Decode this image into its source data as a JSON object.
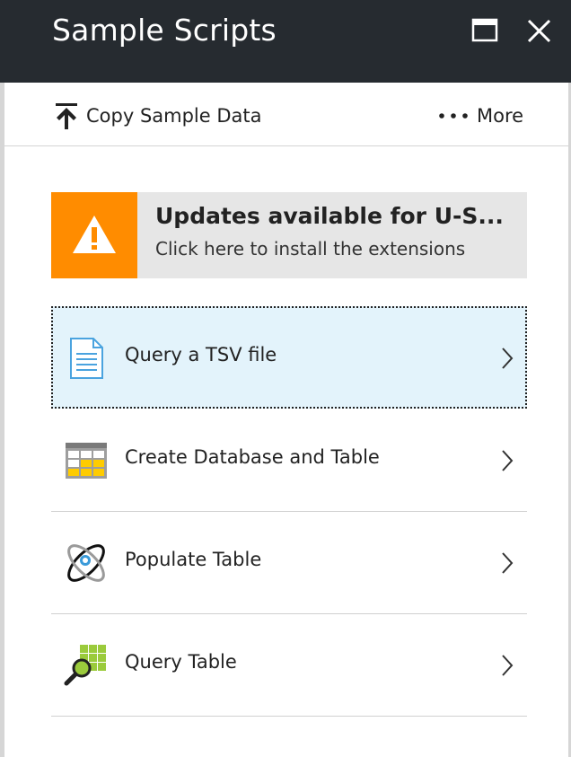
{
  "header": {
    "title": "Sample Scripts",
    "maximize_icon": "maximize-icon",
    "close_icon": "close-icon"
  },
  "toolbar": {
    "copy_label": "Copy Sample Data",
    "copy_icon": "upload-arrow-icon",
    "more_label": "More",
    "more_icon": "ellipsis-icon"
  },
  "banner": {
    "title": "Updates available for U-S...",
    "subtitle": "Click here to install the extensions",
    "icon": "warning-icon",
    "accent_color": "#ff8c00"
  },
  "items": [
    {
      "label": "Query a TSV file",
      "icon": "tsv-file-icon",
      "selected": true
    },
    {
      "label": "Create Database and Table",
      "icon": "database-table-icon",
      "selected": false
    },
    {
      "label": "Populate Table",
      "icon": "populate-orbit-icon",
      "selected": false
    },
    {
      "label": "Query Table",
      "icon": "query-table-icon",
      "selected": false
    }
  ],
  "colors": {
    "title_bar": "#262b30",
    "selected_bg": "#e3f3fb",
    "banner_bg": "#e6e6e6"
  }
}
